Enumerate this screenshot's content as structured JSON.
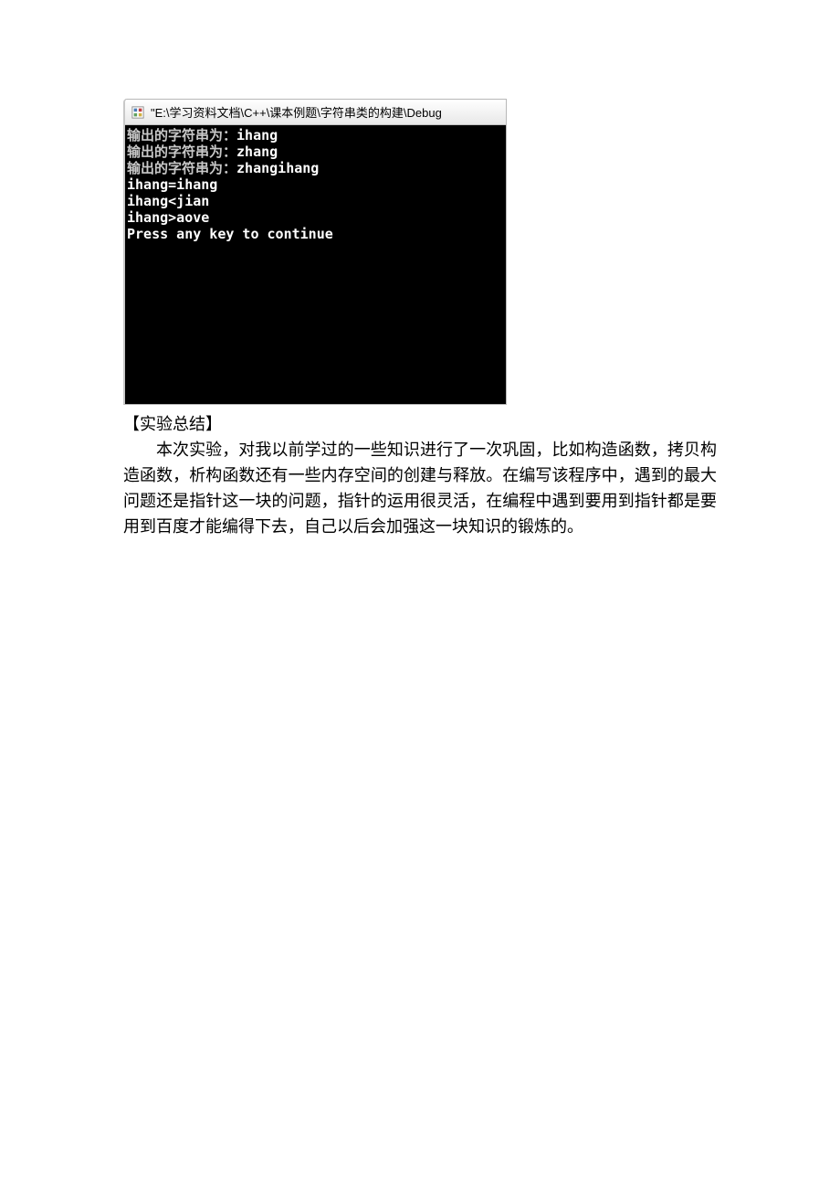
{
  "window": {
    "title": "\"E:\\学习资料文档\\C++\\课本例题\\字符串类的构建\\Debug"
  },
  "console": {
    "line1_prefix": "输出的字符串为：",
    "line1_value": "ihang",
    "line2_prefix": "输出的字符串为：",
    "line2_value": "zhang",
    "line3_prefix": "输出的字符串为：",
    "line3_value": "zhangihang",
    "line4": "ihang=ihang",
    "line5": "ihang<jian",
    "line6": "ihang>aove",
    "line7": "Press any key to continue"
  },
  "doc": {
    "heading": "【实验总结】",
    "body": "本次实验，对我以前学过的一些知识进行了一次巩固，比如构造函数，拷贝构造函数，析构函数还有一些内存空间的创建与释放。在编写该程序中，遇到的最大问题还是指针这一块的问题，指针的运用很灵活，在编程中遇到要用到指针都是要用到百度才能编得下去，自己以后会加强这一块知识的锻炼的。"
  }
}
